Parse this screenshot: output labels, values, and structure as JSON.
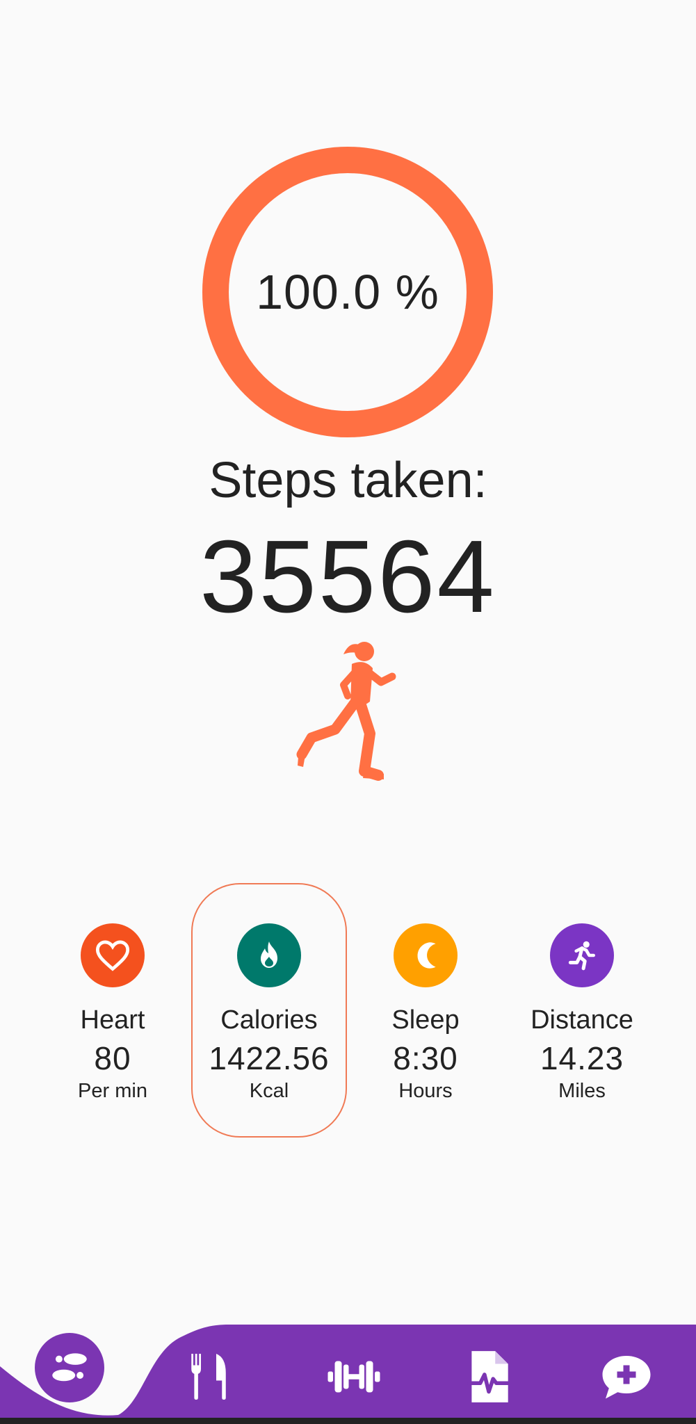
{
  "progress": {
    "label": "100.0 %",
    "fraction": 1.0,
    "color": "#ff7043"
  },
  "steps": {
    "title": "Steps taken:",
    "count": "35564"
  },
  "runner_icon": "running-woman-silhouette",
  "stats": [
    {
      "id": "heart",
      "label": "Heart",
      "value": "80",
      "unit": "Per min",
      "icon": "heart-icon",
      "color": "#f4511e",
      "selected": false
    },
    {
      "id": "calories",
      "label": "Calories",
      "value": "1422.56",
      "unit": "Kcal",
      "icon": "flame-icon",
      "color": "#00796b",
      "selected": true
    },
    {
      "id": "sleep",
      "label": "Sleep",
      "value": "8:30",
      "unit": "Hours",
      "icon": "moon-icon",
      "color": "#ffa000",
      "selected": false
    },
    {
      "id": "distance",
      "label": "Distance",
      "value": "14.23",
      "unit": "Miles",
      "icon": "running-person-icon",
      "color": "#7b35c4",
      "selected": false
    }
  ],
  "nav": {
    "color": "#7b35b2",
    "items": [
      {
        "id": "steps",
        "icon": "footsteps-icon",
        "active": true
      },
      {
        "id": "diet",
        "icon": "fork-knife-icon",
        "active": false
      },
      {
        "id": "workout",
        "icon": "dumbbell-icon",
        "active": false
      },
      {
        "id": "reports",
        "icon": "medical-report-icon",
        "active": false
      },
      {
        "id": "chat",
        "icon": "chat-plus-icon",
        "active": false
      }
    ]
  }
}
